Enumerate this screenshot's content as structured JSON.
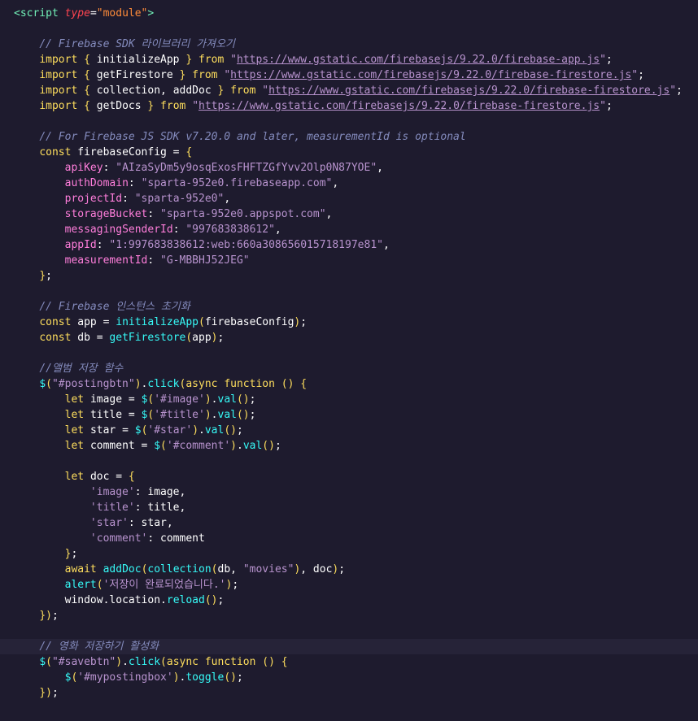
{
  "editor": {
    "language": "javascript",
    "current_line": 41,
    "lines": [
      [
        [
          "t-tag",
          "<script "
        ],
        [
          "t-attr",
          "type"
        ],
        [
          "t-txt",
          "="
        ],
        [
          "t-str",
          "\"module\""
        ],
        [
          "t-tag",
          ">"
        ]
      ],
      [],
      [
        [
          "t-txt",
          "    "
        ],
        [
          "t-cmt",
          "// Firebase SDK 라이브러리 가져오기"
        ]
      ],
      [
        [
          "t-txt",
          "    "
        ],
        [
          "t-kw",
          "import"
        ],
        [
          "t-punc",
          " { "
        ],
        [
          "t-var",
          "initializeApp"
        ],
        [
          "t-punc",
          " } "
        ],
        [
          "t-kw",
          "from"
        ],
        [
          "t-txt",
          " "
        ],
        [
          "t-strs",
          "\""
        ],
        [
          "t-url",
          "https://www.gstatic.com/firebasejs/9.22.0/firebase-app.js"
        ],
        [
          "t-strs",
          "\""
        ],
        [
          "t-txt",
          ";"
        ]
      ],
      [
        [
          "t-txt",
          "    "
        ],
        [
          "t-kw",
          "import"
        ],
        [
          "t-punc",
          " { "
        ],
        [
          "t-var",
          "getFirestore"
        ],
        [
          "t-punc",
          " } "
        ],
        [
          "t-kw",
          "from"
        ],
        [
          "t-txt",
          " "
        ],
        [
          "t-strs",
          "\""
        ],
        [
          "t-url",
          "https://www.gstatic.com/firebasejs/9.22.0/firebase-firestore.js"
        ],
        [
          "t-strs",
          "\""
        ],
        [
          "t-txt",
          ";"
        ]
      ],
      [
        [
          "t-txt",
          "    "
        ],
        [
          "t-kw",
          "import"
        ],
        [
          "t-punc",
          " { "
        ],
        [
          "t-var",
          "collection"
        ],
        [
          "t-txt",
          ", "
        ],
        [
          "t-var",
          "addDoc"
        ],
        [
          "t-punc",
          " } "
        ],
        [
          "t-kw",
          "from"
        ],
        [
          "t-txt",
          " "
        ],
        [
          "t-strs",
          "\""
        ],
        [
          "t-url",
          "https://www.gstatic.com/firebasejs/9.22.0/firebase-firestore.js"
        ],
        [
          "t-strs",
          "\""
        ],
        [
          "t-txt",
          ";"
        ]
      ],
      [
        [
          "t-txt",
          "    "
        ],
        [
          "t-kw",
          "import"
        ],
        [
          "t-punc",
          " { "
        ],
        [
          "t-var",
          "getDocs"
        ],
        [
          "t-punc",
          " } "
        ],
        [
          "t-kw",
          "from"
        ],
        [
          "t-txt",
          " "
        ],
        [
          "t-strs",
          "\""
        ],
        [
          "t-url",
          "https://www.gstatic.com/firebasejs/9.22.0/firebase-firestore.js"
        ],
        [
          "t-strs",
          "\""
        ],
        [
          "t-txt",
          ";"
        ]
      ],
      [],
      [
        [
          "t-txt",
          "    "
        ],
        [
          "t-cmt",
          "// For Firebase JS SDK v7.20.0 and later, measurementId is optional"
        ]
      ],
      [
        [
          "t-txt",
          "    "
        ],
        [
          "t-kw",
          "const"
        ],
        [
          "t-txt",
          " "
        ],
        [
          "t-var",
          "firebaseConfig"
        ],
        [
          "t-txt",
          " = "
        ],
        [
          "t-punc",
          "{"
        ]
      ],
      [
        [
          "t-txt",
          "        "
        ],
        [
          "t-prop",
          "apiKey"
        ],
        [
          "t-txt",
          ": "
        ],
        [
          "t-strs",
          "\"AIzaSyDm5y9osqExosFHFTZGfYvv2Olp0N87YOE\""
        ],
        [
          "t-txt",
          ","
        ]
      ],
      [
        [
          "t-txt",
          "        "
        ],
        [
          "t-prop",
          "authDomain"
        ],
        [
          "t-txt",
          ": "
        ],
        [
          "t-strs",
          "\"sparta-952e0.firebaseapp.com\""
        ],
        [
          "t-txt",
          ","
        ]
      ],
      [
        [
          "t-txt",
          "        "
        ],
        [
          "t-prop",
          "projectId"
        ],
        [
          "t-txt",
          ": "
        ],
        [
          "t-strs",
          "\"sparta-952e0\""
        ],
        [
          "t-txt",
          ","
        ]
      ],
      [
        [
          "t-txt",
          "        "
        ],
        [
          "t-prop",
          "storageBucket"
        ],
        [
          "t-txt",
          ": "
        ],
        [
          "t-strs",
          "\"sparta-952e0.appspot.com\""
        ],
        [
          "t-txt",
          ","
        ]
      ],
      [
        [
          "t-txt",
          "        "
        ],
        [
          "t-prop",
          "messagingSenderId"
        ],
        [
          "t-txt",
          ": "
        ],
        [
          "t-strs",
          "\"997683838612\""
        ],
        [
          "t-txt",
          ","
        ]
      ],
      [
        [
          "t-txt",
          "        "
        ],
        [
          "t-prop",
          "appId"
        ],
        [
          "t-txt",
          ": "
        ],
        [
          "t-strs",
          "\"1:997683838612:web:660a308656015718197e81\""
        ],
        [
          "t-txt",
          ","
        ]
      ],
      [
        [
          "t-txt",
          "        "
        ],
        [
          "t-prop",
          "measurementId"
        ],
        [
          "t-txt",
          ": "
        ],
        [
          "t-strs",
          "\"G-MBBHJ52JEG\""
        ]
      ],
      [
        [
          "t-txt",
          "    "
        ],
        [
          "t-punc",
          "}"
        ],
        [
          "t-txt",
          ";"
        ]
      ],
      [],
      [
        [
          "t-txt",
          "    "
        ],
        [
          "t-cmt",
          "// Firebase 인스턴스 초기화"
        ]
      ],
      [
        [
          "t-txt",
          "    "
        ],
        [
          "t-kw",
          "const"
        ],
        [
          "t-txt",
          " "
        ],
        [
          "t-var",
          "app"
        ],
        [
          "t-txt",
          " = "
        ],
        [
          "t-fn",
          "initializeApp"
        ],
        [
          "t-punc",
          "("
        ],
        [
          "t-var",
          "firebaseConfig"
        ],
        [
          "t-punc",
          ")"
        ],
        [
          "t-txt",
          ";"
        ]
      ],
      [
        [
          "t-txt",
          "    "
        ],
        [
          "t-kw",
          "const"
        ],
        [
          "t-txt",
          " "
        ],
        [
          "t-var",
          "db"
        ],
        [
          "t-txt",
          " = "
        ],
        [
          "t-fn",
          "getFirestore"
        ],
        [
          "t-punc",
          "("
        ],
        [
          "t-var",
          "app"
        ],
        [
          "t-punc",
          ")"
        ],
        [
          "t-txt",
          ";"
        ]
      ],
      [],
      [
        [
          "t-txt",
          "    "
        ],
        [
          "t-cmt",
          "//앨범 저장 함수"
        ]
      ],
      [
        [
          "t-txt",
          "    "
        ],
        [
          "t-fn",
          "$"
        ],
        [
          "t-punc",
          "("
        ],
        [
          "t-strs",
          "\"#postingbtn\""
        ],
        [
          "t-punc",
          ")"
        ],
        [
          "t-txt",
          "."
        ],
        [
          "t-fn",
          "click"
        ],
        [
          "t-punc",
          "("
        ],
        [
          "t-kw",
          "async"
        ],
        [
          "t-txt",
          " "
        ],
        [
          "t-kw",
          "function"
        ],
        [
          "t-txt",
          " "
        ],
        [
          "t-punc",
          "()"
        ],
        [
          "t-txt",
          " "
        ],
        [
          "t-punc",
          "{"
        ]
      ],
      [
        [
          "t-txt",
          "        "
        ],
        [
          "t-kw",
          "let"
        ],
        [
          "t-txt",
          " "
        ],
        [
          "t-var",
          "image"
        ],
        [
          "t-txt",
          " = "
        ],
        [
          "t-fn",
          "$"
        ],
        [
          "t-punc",
          "("
        ],
        [
          "t-strs",
          "'#image'"
        ],
        [
          "t-punc",
          ")"
        ],
        [
          "t-txt",
          "."
        ],
        [
          "t-fn",
          "val"
        ],
        [
          "t-punc",
          "()"
        ],
        [
          "t-txt",
          ";"
        ]
      ],
      [
        [
          "t-txt",
          "        "
        ],
        [
          "t-kw",
          "let"
        ],
        [
          "t-txt",
          " "
        ],
        [
          "t-var",
          "title"
        ],
        [
          "t-txt",
          " = "
        ],
        [
          "t-fn",
          "$"
        ],
        [
          "t-punc",
          "("
        ],
        [
          "t-strs",
          "'#title'"
        ],
        [
          "t-punc",
          ")"
        ],
        [
          "t-txt",
          "."
        ],
        [
          "t-fn",
          "val"
        ],
        [
          "t-punc",
          "()"
        ],
        [
          "t-txt",
          ";"
        ]
      ],
      [
        [
          "t-txt",
          "        "
        ],
        [
          "t-kw",
          "let"
        ],
        [
          "t-txt",
          " "
        ],
        [
          "t-var",
          "star"
        ],
        [
          "t-txt",
          " = "
        ],
        [
          "t-fn",
          "$"
        ],
        [
          "t-punc",
          "("
        ],
        [
          "t-strs",
          "'#star'"
        ],
        [
          "t-punc",
          ")"
        ],
        [
          "t-txt",
          "."
        ],
        [
          "t-fn",
          "val"
        ],
        [
          "t-punc",
          "()"
        ],
        [
          "t-txt",
          ";"
        ]
      ],
      [
        [
          "t-txt",
          "        "
        ],
        [
          "t-kw",
          "let"
        ],
        [
          "t-txt",
          " "
        ],
        [
          "t-var",
          "comment"
        ],
        [
          "t-txt",
          " = "
        ],
        [
          "t-fn",
          "$"
        ],
        [
          "t-punc",
          "("
        ],
        [
          "t-strs",
          "'#comment'"
        ],
        [
          "t-punc",
          ")"
        ],
        [
          "t-txt",
          "."
        ],
        [
          "t-fn",
          "val"
        ],
        [
          "t-punc",
          "()"
        ],
        [
          "t-txt",
          ";"
        ]
      ],
      [],
      [
        [
          "t-txt",
          "        "
        ],
        [
          "t-kw",
          "let"
        ],
        [
          "t-txt",
          " "
        ],
        [
          "t-var",
          "doc"
        ],
        [
          "t-txt",
          " = "
        ],
        [
          "t-punc",
          "{"
        ]
      ],
      [
        [
          "t-txt",
          "            "
        ],
        [
          "t-strs",
          "'image'"
        ],
        [
          "t-txt",
          ": "
        ],
        [
          "t-var",
          "image"
        ],
        [
          "t-txt",
          ","
        ]
      ],
      [
        [
          "t-txt",
          "            "
        ],
        [
          "t-strs",
          "'title'"
        ],
        [
          "t-txt",
          ": "
        ],
        [
          "t-var",
          "title"
        ],
        [
          "t-txt",
          ","
        ]
      ],
      [
        [
          "t-txt",
          "            "
        ],
        [
          "t-strs",
          "'star'"
        ],
        [
          "t-txt",
          ": "
        ],
        [
          "t-var",
          "star"
        ],
        [
          "t-txt",
          ","
        ]
      ],
      [
        [
          "t-txt",
          "            "
        ],
        [
          "t-strs",
          "'comment'"
        ],
        [
          "t-txt",
          ": "
        ],
        [
          "t-var",
          "comment"
        ]
      ],
      [
        [
          "t-txt",
          "        "
        ],
        [
          "t-punc",
          "}"
        ],
        [
          "t-txt",
          ";"
        ]
      ],
      [
        [
          "t-txt",
          "        "
        ],
        [
          "t-kw",
          "await"
        ],
        [
          "t-txt",
          " "
        ],
        [
          "t-fn",
          "addDoc"
        ],
        [
          "t-punc",
          "("
        ],
        [
          "t-fn",
          "collection"
        ],
        [
          "t-punc",
          "("
        ],
        [
          "t-var",
          "db"
        ],
        [
          "t-txt",
          ", "
        ],
        [
          "t-strs",
          "\"movies\""
        ],
        [
          "t-punc",
          ")"
        ],
        [
          "t-txt",
          ", "
        ],
        [
          "t-var",
          "doc"
        ],
        [
          "t-punc",
          ")"
        ],
        [
          "t-txt",
          ";"
        ]
      ],
      [
        [
          "t-txt",
          "        "
        ],
        [
          "t-fn",
          "alert"
        ],
        [
          "t-punc",
          "("
        ],
        [
          "t-strs",
          "'저장이 완료되었습니다.'"
        ],
        [
          "t-punc",
          ")"
        ],
        [
          "t-txt",
          ";"
        ]
      ],
      [
        [
          "t-txt",
          "        "
        ],
        [
          "t-var",
          "window"
        ],
        [
          "t-txt",
          "."
        ],
        [
          "t-var",
          "location"
        ],
        [
          "t-txt",
          "."
        ],
        [
          "t-fn",
          "reload"
        ],
        [
          "t-punc",
          "()"
        ],
        [
          "t-txt",
          ";"
        ]
      ],
      [
        [
          "t-txt",
          "    "
        ],
        [
          "t-punc",
          "})"
        ],
        [
          "t-txt",
          ";"
        ]
      ],
      [],
      [
        [
          "t-txt",
          "    "
        ],
        [
          "t-cmt",
          "// 영화 저장하기 활성화"
        ]
      ],
      [
        [
          "t-txt",
          "    "
        ],
        [
          "t-fn",
          "$"
        ],
        [
          "t-punc",
          "("
        ],
        [
          "t-strs",
          "\"#savebtn\""
        ],
        [
          "t-punc",
          ")"
        ],
        [
          "t-txt",
          "."
        ],
        [
          "t-fn",
          "click"
        ],
        [
          "t-punc",
          "("
        ],
        [
          "t-kw",
          "async"
        ],
        [
          "t-txt",
          " "
        ],
        [
          "t-kw",
          "function"
        ],
        [
          "t-txt",
          " "
        ],
        [
          "t-punc",
          "()"
        ],
        [
          "t-txt",
          " "
        ],
        [
          "t-punc",
          "{"
        ]
      ],
      [
        [
          "t-txt",
          "        "
        ],
        [
          "t-fn",
          "$"
        ],
        [
          "t-punc",
          "("
        ],
        [
          "t-strs",
          "'#mypostingbox'"
        ],
        [
          "t-punc",
          ")"
        ],
        [
          "t-txt",
          "."
        ],
        [
          "t-fn",
          "toggle"
        ],
        [
          "t-punc",
          "()"
        ],
        [
          "t-txt",
          ";"
        ]
      ],
      [
        [
          "t-txt",
          "    "
        ],
        [
          "t-punc",
          "})"
        ],
        [
          "t-txt",
          ";"
        ]
      ]
    ]
  }
}
